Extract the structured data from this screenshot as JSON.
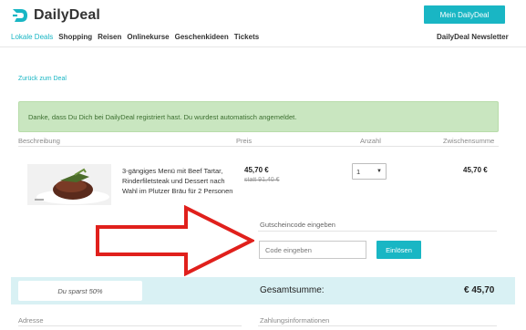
{
  "brand": {
    "name": "DailyDeal",
    "color": "#19b6c4"
  },
  "header": {
    "account_button": "Mein DailyDeal",
    "newsletter": "DailyDeal Newsletter",
    "nav": [
      "Lokale Deals",
      "Shopping",
      "Reisen",
      "Onlinekurse",
      "Geschenkideen",
      "Tickets"
    ]
  },
  "back_link": "Zurück zum Deal",
  "alert": "Danke, dass Du Dich bei DailyDeal registriert hast. Du wurdest automatisch angemeldet.",
  "columns": {
    "description": "Beschreibung",
    "price": "Preis",
    "quantity": "Anzahl",
    "subtotal": "Zwischensumme"
  },
  "product": {
    "description": "3-gängiges Menü mit Beef Tartar, Rinderfiletsteak und Dessert nach Wahl im Plutzer Bräu für 2 Personen",
    "price": "45,70 €",
    "old_price": "statt 91,40 €",
    "quantity": "1",
    "subtotal": "45,70 €"
  },
  "coupon": {
    "label": "Gutscheincode eingeben",
    "placeholder": "Code eingeben",
    "button": "Einlösen"
  },
  "totals": {
    "savings": "Du sparst 50%",
    "label": "Gesamtsumme:",
    "value": "€ 45,70"
  },
  "footer": {
    "address": "Adresse",
    "payment": "Zahlungsinformationen"
  }
}
